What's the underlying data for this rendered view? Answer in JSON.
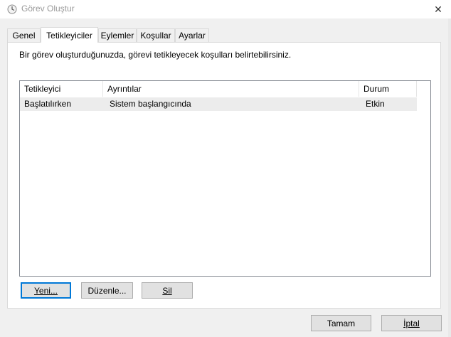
{
  "window": {
    "title": "Görev Oluştur",
    "close_glyph": "✕"
  },
  "tabs": [
    "Genel",
    "Tetikleyiciler",
    "Eylemler",
    "Koşullar",
    "Ayarlar"
  ],
  "active_tab": "Tetikleyiciler",
  "description": "Bir görev oluşturduğunuzda, görevi tetikleyecek koşulları belirtebilirsiniz.",
  "table": {
    "headers": [
      "Tetikleyici",
      "Ayrıntılar",
      "Durum"
    ],
    "rows": [
      [
        "Başlatılırken",
        "Sistem başlangıcında",
        "Etkin"
      ]
    ]
  },
  "buttons": {
    "new": "Yeni...",
    "edit": "Düzenle...",
    "delete": "Sil",
    "ok": "Tamam",
    "cancel": "İptal"
  },
  "colors": {
    "focus_border": "#0078d7",
    "selected_row": "#ececec"
  },
  "icons": {
    "window": "clock-icon",
    "close": "close-icon"
  }
}
